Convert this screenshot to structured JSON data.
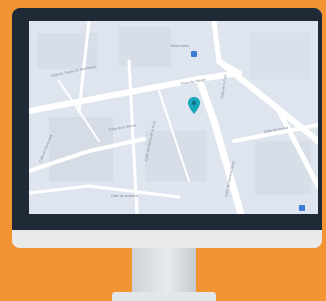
{
  "map": {
    "labels": {
      "poi_1": "Mesa Hotel",
      "street_1": "Calle de Toledo de Hermanos",
      "street_2": "Calle de la Arena",
      "street_3": "Calle de Santa Ana",
      "street_4": "Calle del Barrio de la Cruz",
      "street_5": "Calle de la Sirena",
      "street_6": "Plaza de Tetuán",
      "street_7": "Calle del Arenal",
      "street_8": "Calle del General Tovar",
      "street_9": "Calle de la Cruz"
    },
    "colors": {
      "monitor_bezel": "#1f2a36",
      "map_background": "#dfe5ee",
      "road": "#ffffff",
      "marker": "#1aa4ba",
      "poi_icon": "#3d7bd9",
      "background": "#f29434"
    }
  }
}
